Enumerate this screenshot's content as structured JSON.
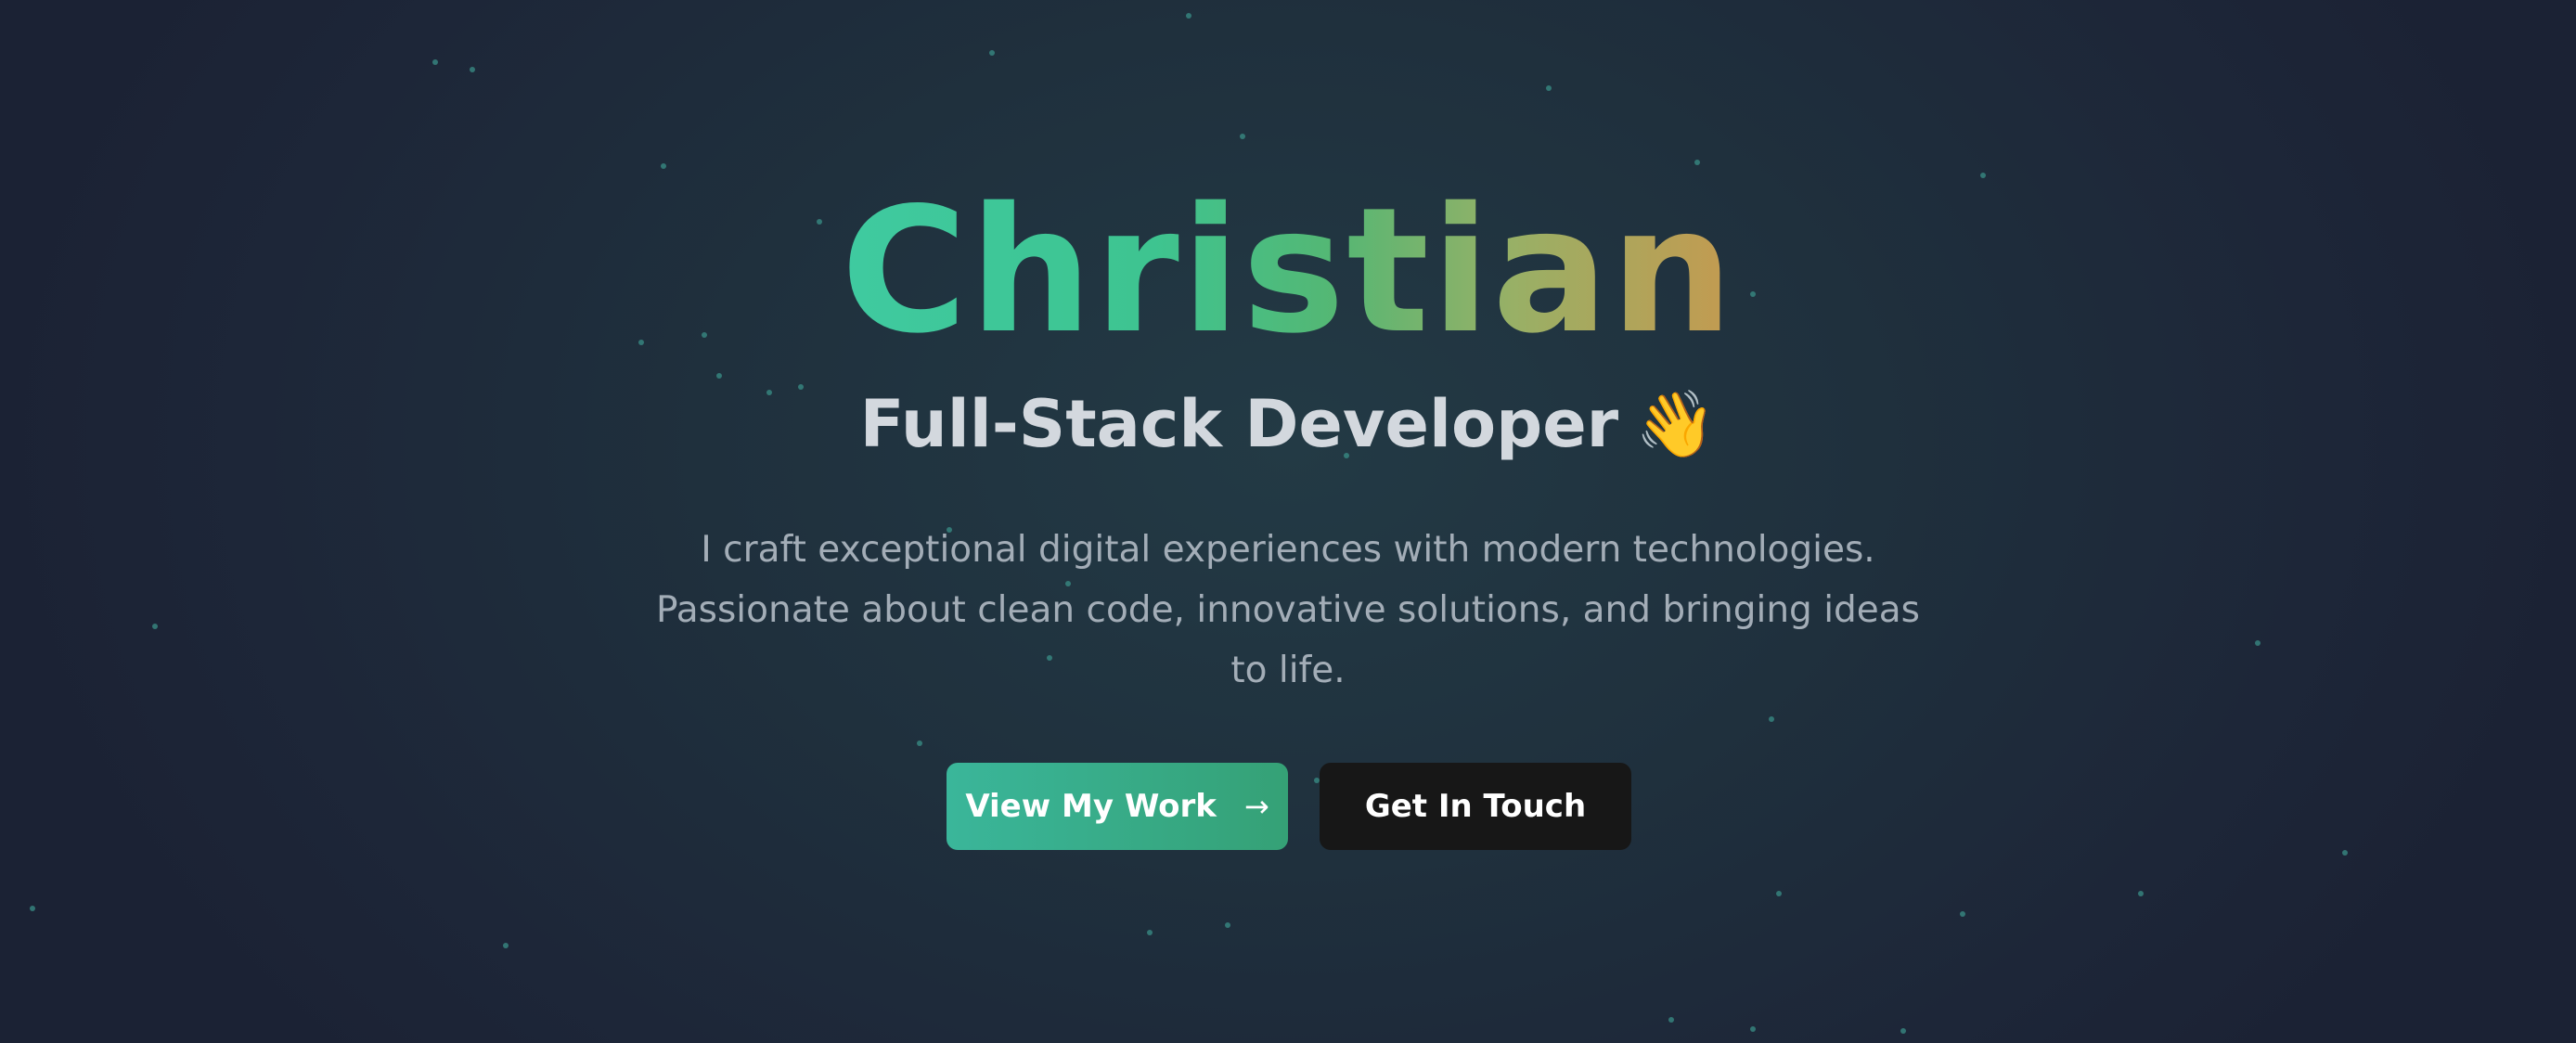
{
  "hero": {
    "name": "Christian",
    "role": "Full-Stack Developer",
    "role_emoji": "👋",
    "description": "I craft exceptional digital experiences with modern technologies. Passionate about clean code, innovative solutions, and bringing ideas to life.",
    "primary_button": {
      "label": "View My Work",
      "icon": "arrow-right-icon",
      "icon_glyph": "→"
    },
    "secondary_button": {
      "label": "Get In Touch"
    }
  },
  "colors": {
    "background": "#1f2c3b",
    "name_gradient_start": "#3fcaa0",
    "name_gradient_end": "#c49a50",
    "primary_button": "#39b08e",
    "secondary_button": "#171717",
    "particle": "#3a8f87"
  }
}
